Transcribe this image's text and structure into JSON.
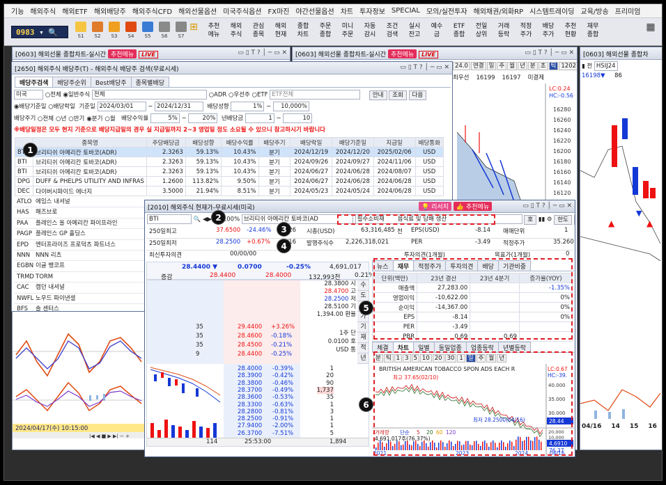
{
  "menu": [
    "기능",
    "해외주식",
    "해외ETF",
    "해외배당주",
    "해외주식CFD",
    "해외선물옵션",
    "미국주식옵션",
    "FX마진",
    "야간선물옵션",
    "차트",
    "투자정보",
    "SPECIAL",
    "모의/실전투자",
    "해외채권/외화RP",
    "시스템트레이딩",
    "교육/방송",
    "프리미엄"
  ],
  "toolbar": {
    "code": "0983",
    "btn_labels": [
      "S1",
      "S2",
      "S3",
      "S4",
      "S5",
      "S6",
      "S7"
    ],
    "menus": [
      "추천\n메뉴",
      "해외\n주식",
      "관심\n종목",
      "해외\n현재",
      "종합\n차트",
      "주문\n종합",
      "미니\n주문",
      "자동\n감시",
      "조건\n검색",
      "실시\n잔고",
      "예수\n금",
      "ETF\n종합",
      "전일\n상위",
      "거래\n등락",
      "적정\n주가",
      "배당\n주가",
      "추천\n현황",
      "재무\n종합"
    ]
  },
  "bg_windows": {
    "w1_title": "[0603] 해외선물 종합차트-실시간",
    "w2_title": "[0603] 해외선물 종합차트-실시간",
    "w3_title": "[0603] 해외선물 종합차",
    "rec": "추천메뉴",
    "live": "LIVE",
    "w2_vals": [
      "24.0",
      "연결",
      "일",
      "주",
      "월",
      "년",
      "분",
      "초",
      "틱",
      "1202"
    ],
    "w2_row2": [
      "최우선",
      "16199",
      "16197",
      "미결제"
    ],
    "w2_prices": [
      "16280",
      "16260",
      "16240",
      "16220",
      "16200",
      "16180",
      "16160",
      "16140",
      "16120",
      "16100",
      "16080",
      "16060",
      "16040"
    ],
    "w2_lc": "LC:0.24",
    "w2_hc": "HC:-0.56",
    "w3_code": "HSIJ24",
    "w3_vals": [
      "16198▼",
      "86"
    ],
    "w3_bottom": [
      "04/16",
      "14",
      "15",
      "16"
    ],
    "w1_date": "2024/04/17(수) 10:15:00"
  },
  "div": {
    "title": "[2650] 해외주식 배당주(T) - 해외주식 배당주 검색(무료시세)",
    "tabs": [
      "배당주검색",
      "배당주순위",
      "Best배당주",
      "종목별배당"
    ],
    "market": "미국",
    "radios1": [
      "전체",
      "일반주식"
    ],
    "sel1": "전체",
    "radios2": [
      "ADR",
      "우선주",
      "ETF"
    ],
    "etf_sel": "ETF전체",
    "buttons": [
      "안내",
      "조회",
      "다음"
    ],
    "row2": {
      "r1": "배당기준일",
      "r2": "배당락일",
      "label": "기준일",
      "from": "2024/03/01",
      "to": "2024/12/31",
      "yield_label": "배당성향",
      "ymin": "1%",
      "ymax": "10,000%"
    },
    "row3": {
      "label": "배당주기",
      "opts": [
        "전체",
        "년",
        "반기",
        "분기",
        "월"
      ],
      "rlabel": "배당수익율",
      "rmin": "5%",
      "rmax": "20%",
      "ylabel": "년배당금",
      "ymin": "1",
      "ymax": "10"
    },
    "note": "※배당일정은 모두 현지 기준으로 배당지급일의 경우 실 지급일까지 2~3 영업일 정도 소요될 수 있으니 참고하시기 바랍니다",
    "headers": [
      "",
      "종목명",
      "주당배당금",
      "배당성향",
      "배당수익률",
      "배당주기",
      "배당락일",
      "배당기준일",
      "지급일",
      "배당통화"
    ],
    "rows": [
      [
        "BTI",
        "브리티쉬 아메리칸 토바코(ADR)",
        "2.3263",
        "59.13%",
        "10.43%",
        "분기",
        "2024/12/19",
        "2024/12/20",
        "2025/02/06",
        "USD"
      ],
      [
        "BTI",
        "브리티쉬 아메리칸 토바코(ADR)",
        "2.3263",
        "59.13%",
        "10.43%",
        "분기",
        "2024/09/26",
        "2024/09/27",
        "2024/11/06",
        "USD"
      ],
      [
        "BTI",
        "브리티쉬 아메리칸 토바코(ADR)",
        "2.3263",
        "59.13%",
        "10.43%",
        "분기",
        "2024/06/27",
        "2024/06/28",
        "2024/08/07",
        "USD"
      ],
      [
        "DPG",
        "DUFF & PHELPS UTILITY AND INFRAS",
        "1.2600",
        "113.82%",
        "9.50%",
        "분기",
        "2024/06/27",
        "2024/06/28",
        "2024/06/28",
        "USD"
      ],
      [
        "DEC",
        "다이버시파이드 에너지",
        "3.5000",
        "21.94%",
        "8.51%",
        "분기",
        "2024/05/23",
        "2024/05/24",
        "2024/06/28",
        "USD"
      ]
    ],
    "codes": [
      [
        "ATLO",
        "에임스 내셔널"
      ],
      [
        "HAS",
        "해즈브로"
      ],
      [
        "PAA",
        "플레인스 올 아메리칸 파이프라인"
      ],
      [
        "PAGP",
        "플레인스 GP 홀딩스"
      ],
      [
        "EPD",
        "엔터프라이즈 프로덕츠 파트너스"
      ],
      [
        "NNN",
        "NNN 리츠"
      ],
      [
        "EGBN",
        "이글 뱅코프"
      ],
      [
        "TRMD",
        "TORM"
      ],
      [
        "CAC",
        "캠던 내셔널"
      ],
      [
        "NWFL",
        "노우드 파이낸셜"
      ],
      [
        "BFS",
        "솔 센터스"
      ]
    ]
  },
  "cur": {
    "title": "[2010] 해외주식 현재가-무료시세(미국)",
    "research": "리서치",
    "rec": "추천메뉴",
    "code": "BTI",
    "mark": "N",
    "margin": "100%",
    "name": "브리티쉬 아메리칸 토바코(AD",
    "sector": "필수소비재",
    "industry": "음식료 및 담배 생산",
    "buttons": [
      "호",
      "한도",
      "조회"
    ],
    "r1": {
      "l": "250일최고",
      "v": "37.6500",
      "p": "-24.46%",
      "d": "4/26",
      "l2": "시총(USD)",
      "v2": "63,316,485",
      "u2": "천",
      "l3": "EPS(USD)",
      "v3": "-8.14",
      "l4": "매매단위",
      "v4": "1"
    },
    "r2": {
      "l": "250일최저",
      "v": "28.2500",
      "p": "+0.67%",
      "d": "4/16",
      "l2": "발행주식수",
      "v2": "2,226,318,021",
      "l3": "PER",
      "v3": "-3.49",
      "l4": "적정주가",
      "v4": "35.260"
    },
    "r3": {
      "l": "최신투자의견",
      "v": "00/00/00",
      "d": "00/00/00",
      "l2": "투자의견(1개월)",
      "l3": "목표가(1개월)",
      "v3": "0"
    },
    "price": "28.4400",
    "arrow": "▼",
    "chg": "0.0700",
    "pct": "-0.25%",
    "vol": "4,691,017",
    "l_jg": "증감",
    "bid": "28.4400",
    "ask": "28.4000",
    "amt": "132,993천",
    "ratio": "0.21%",
    "ohl": [
      [
        "28.3800",
        "시"
      ],
      [
        "28.4700",
        "고"
      ],
      [
        "28.2500",
        "저"
      ],
      [
        "28.5100",
        "기"
      ],
      [
        "1,394.00",
        "환율"
      ]
    ],
    "side_tabs": [
      "수",
      "도",
      "호",
      "가",
      "기",
      "재",
      "적",
      "년"
    ],
    "info": {
      "l1": "1주",
      "v1": "0.0100",
      "l2": "USD",
      "v2": "단",
      "v3": "호",
      "v4": "통"
    },
    "ask_rows": [
      [
        "35",
        "29.4400",
        "+3.26%"
      ],
      [
        "35",
        "28.4600",
        "-0.18%"
      ],
      [
        "35",
        "28.4500",
        "-0.21%"
      ],
      [
        "9",
        "28.4400",
        "-0.25%"
      ]
    ],
    "bid_rows": [
      [
        "28.4000",
        "-0.39%",
        "1"
      ],
      [
        "28.3900",
        "-0.42%",
        "20"
      ],
      [
        "28.3800",
        "-0.46%",
        "90"
      ],
      [
        "28.3700",
        "-0.49%",
        "1,737"
      ],
      [
        "28.3600",
        "-0.53%",
        "35"
      ],
      [
        "28.3300",
        "-0.63%",
        "1"
      ],
      [
        "28.2800",
        "-0.81%",
        "3"
      ],
      [
        "28.2500",
        "-0.91%",
        "1"
      ],
      [
        "27.9400",
        "-2.00%",
        "1"
      ],
      [
        "26.3700",
        "-7.51%",
        "5"
      ]
    ],
    "foot": [
      "114",
      "25:53:00",
      "1,894"
    ],
    "fin_tabs": [
      "뉴스",
      "재무",
      "적정주가",
      "투자의견",
      "배당",
      "기관비중"
    ],
    "fin_headers": [
      "단위(백만)",
      "23년 결산",
      "23년 4분기",
      "증가율(YOY)"
    ],
    "fin_rows": [
      [
        "매출액",
        "27,283.00",
        "",
        "-1.35%"
      ],
      [
        "영업이익",
        "-10,622.00",
        "",
        "0%"
      ],
      [
        "순이익",
        "-14,367.00",
        "",
        "0%"
      ],
      [
        "EPS",
        "-8.14",
        "",
        "0%"
      ],
      [
        "PER",
        "-3.49",
        "",
        ""
      ],
      [
        "PBR",
        "0.69",
        "0.69",
        ""
      ]
    ],
    "chart_tabs": [
      "체결",
      "차트",
      "일별",
      "동일업종",
      "업종등락",
      "년별등락"
    ],
    "chart_bar": [
      "분",
      "틱",
      "1",
      "3",
      "5",
      "10",
      "20",
      "30",
      "1",
      "일",
      "주",
      "월",
      "년"
    ],
    "chart_title": "BRITISH AMERICAN TOBACCO SPON ADS EACH R",
    "chart_lc": "LC:0.67",
    "chart_hc": "HC:-39.",
    "high_lbl": "최고 37.65(02/10)",
    "low_lbl": "최저 28.2500(04/16)",
    "price_tag": "28.44",
    "vol_lbl": "거래량",
    "vol_unit": "단순",
    "ma": [
      "5",
      "20",
      "60",
      "120"
    ],
    "vol_val": "4,691,017주(76.37%)",
    "vol_tag": "4,6910",
    "vol_pct": "76.37",
    "x_labels": [
      "2021",
      "2023",
      "2024",
      "04/16"
    ],
    "price_axis": [
      "40.000",
      "35.000",
      "30.000"
    ],
    "vol_axis": [
      "20,000",
      "10,000"
    ]
  },
  "badges": [
    "1",
    "2",
    "3",
    "4",
    "5",
    "6"
  ]
}
